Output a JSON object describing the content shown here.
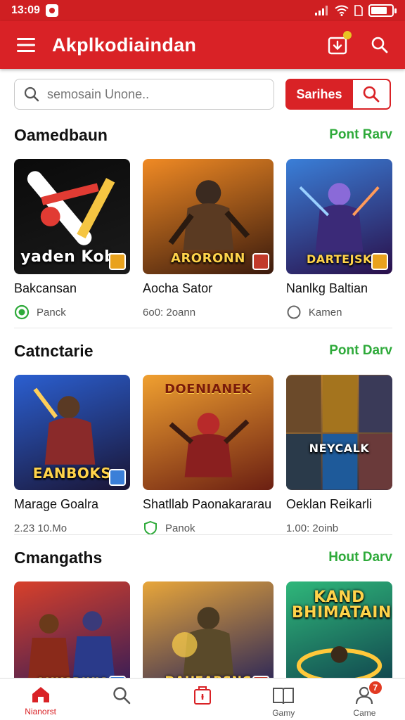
{
  "status_bar": {
    "time": "13:09",
    "battery_level": 0.8
  },
  "app_bar": {
    "title": "Akplkodiaindan"
  },
  "search": {
    "placeholder": "semosain Unone..",
    "button_label": "Sarihes"
  },
  "sections": [
    {
      "title": "Oamedbaun",
      "link": "Pont Rarv",
      "cards": [
        {
          "title": "Bakcansan",
          "meta": "Panck",
          "meta_icon": "shield-check-icon",
          "banner": "yaden Kobr",
          "colors": [
            "#0a0a0a",
            "#1b1b1b"
          ]
        },
        {
          "title": "Aocha Sator",
          "meta": "6o0: 2oann",
          "meta_icon": "",
          "banner": "ARORONN",
          "colors": [
            "#f08a24",
            "#3a1a0d"
          ]
        },
        {
          "title": "Nanlkg Baltian",
          "meta": "Kamen",
          "meta_icon": "circle-icon",
          "banner": "DARTEJSK",
          "colors": [
            "#3a7fd8",
            "#2a0f4a"
          ]
        }
      ]
    },
    {
      "title": "Catnctarie",
      "link": "Pont Darv",
      "cards": [
        {
          "title": "Marage Goalra",
          "meta": "2.23 10.Mo",
          "meta_icon": "",
          "banner": "EANBOKS",
          "colors": [
            "#2b5fd0",
            "#1a1535"
          ]
        },
        {
          "title": "Shatllab Paonakararau",
          "meta": "Panok",
          "meta_icon": "shield-icon",
          "banner": "DOENIANEK",
          "colors": [
            "#f0a030",
            "#6b1f12"
          ]
        },
        {
          "title": "Oeklan Reikarli",
          "meta": "1.00: 2oinb",
          "meta_icon": "",
          "banner": "NEYCALK",
          "colors": [
            "#c9872a",
            "#2a2a40"
          ]
        }
      ]
    },
    {
      "title": "Cmangaths",
      "link": "Hout Darv",
      "cards": [
        {
          "title": "",
          "meta": "",
          "meta_icon": "",
          "banner": "AHKSRIKIS",
          "colors": [
            "#d8402a",
            "#2a1a5a"
          ]
        },
        {
          "title": "",
          "meta": "",
          "meta_icon": "",
          "banner": "DAHEARSNC",
          "colors": [
            "#e8a63a",
            "#1c1c5a"
          ]
        },
        {
          "title": "",
          "meta": "",
          "meta_icon": "",
          "banner": "KAND BHIMATAIN",
          "colors": [
            "#2fb77a",
            "#0e3a4a"
          ]
        }
      ]
    }
  ],
  "bottom_nav": {
    "items": [
      {
        "label": "Nianorst",
        "icon": "home-icon",
        "active": true
      },
      {
        "label": "",
        "icon": "search-icon",
        "active": false
      },
      {
        "label": "",
        "icon": "gift-icon",
        "active": false
      },
      {
        "label": "Gamy",
        "icon": "book-icon",
        "active": false
      },
      {
        "label": "Came",
        "icon": "profile-icon",
        "active": false,
        "badge": "7"
      }
    ]
  },
  "colors": {
    "primary": "#d92226",
    "link": "#2eaa3a"
  }
}
